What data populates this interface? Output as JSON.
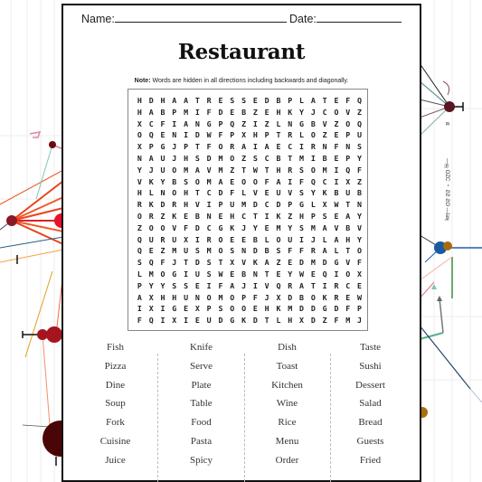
{
  "header": {
    "name_label": "Name:",
    "date_label": "Date:"
  },
  "title": "Restaurant",
  "note": {
    "prefix": "Note:",
    "text": " Words are hidden in all directions including backwards and diagonally."
  },
  "grid": [
    "HDHAATRESSEDBPLATEFQ",
    "HABPMIFDEBZEHKYJCOVZ",
    "XCFIANGPQZIZLNGBVZOQ",
    "OQENIDWFPXHPTRLOZEPU",
    "XPGJPTFORAIAECIRNFNS",
    "NAUJHSDMOZSCBTMIBEPY",
    "YJUOMAVMZTWTHRSOMIQF",
    "VKYBSOMAEOOFAIFQCIXZ",
    "HLNOHTCDFLVEUVSYKBUB",
    "RKDRHVIPUMDCDPGLXWTN",
    "ORZKEBNEHCTIKZHPSEAY",
    "ZOOVFDCGKJYEMYSMAVBV",
    "QURUXIROEEBLOUIJLAHY",
    "QEZMUSMOSNDBSFFRALTO",
    "SQFJTDSTXVKAZEDMDGVF",
    "LMOGIUSWEBNTEYWEQIOX",
    "PYYSSEIFAJIVQRATIRCE",
    "AXHHUNOMOPFJXDBOKREW",
    "IXIGEXPSOOEHKMDDGDFP",
    "FQIXIEUDGKDTLHXDZFMJ"
  ],
  "word_columns": [
    [
      "Fish",
      "Pizza",
      "Dine",
      "Soup",
      "Fork",
      "Cuisine",
      "Juice"
    ],
    [
      "Knife",
      "Serve",
      "Plate",
      "Table",
      "Food",
      "Pasta",
      "Spicy"
    ],
    [
      "Dish",
      "Toast",
      "Kitchen",
      "Wine",
      "Rice",
      "Menu",
      "Order"
    ],
    [
      "Taste",
      "Sushi",
      "Dessert",
      "Salad",
      "Bread",
      "Guests",
      "Fried"
    ]
  ],
  "colors": {
    "page_border": "#111111",
    "text": "#222222",
    "accent_dark_red": "#5a0a0a",
    "accent_red": "#b01020",
    "accent_orange": "#f05a28",
    "accent_blue": "#1f5fa8",
    "accent_gold": "#b07a10"
  }
}
